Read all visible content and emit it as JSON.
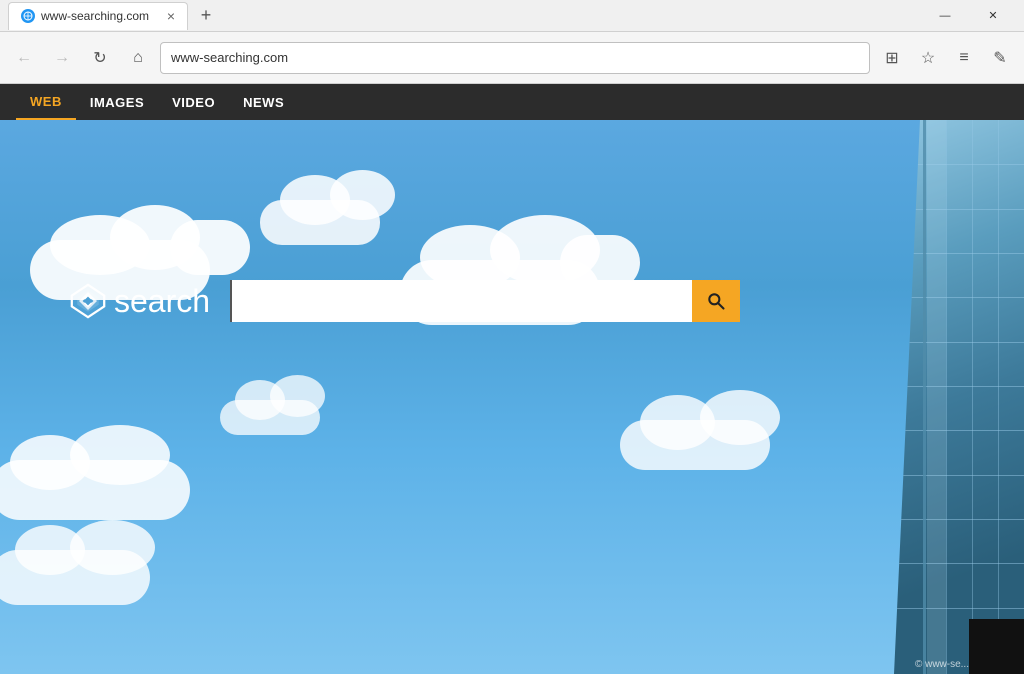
{
  "browser": {
    "tab_title": "www-searching.com",
    "tab_favicon_alt": "globe-icon",
    "close_tab_label": "×",
    "new_tab_label": "+",
    "window_controls": {
      "minimize": "—",
      "close": "✕"
    },
    "address_bar": {
      "url": "www-searching.com",
      "back_label": "←",
      "forward_label": "→",
      "refresh_label": "↻",
      "home_label": "⌂"
    },
    "addr_icons": {
      "split_view": "⊞",
      "favorites": "☆",
      "menu": "≡",
      "annotate": "✎"
    }
  },
  "site_nav": {
    "items": [
      {
        "id": "web",
        "label": "WEB",
        "active": true
      },
      {
        "id": "images",
        "label": "IMAGES",
        "active": false
      },
      {
        "id": "video",
        "label": "VIDEO",
        "active": false
      },
      {
        "id": "news",
        "label": "NEWS",
        "active": false
      }
    ]
  },
  "search": {
    "logo_text": "search",
    "input_placeholder": "",
    "button_label": "Search"
  },
  "copyright": "© www-se..."
}
